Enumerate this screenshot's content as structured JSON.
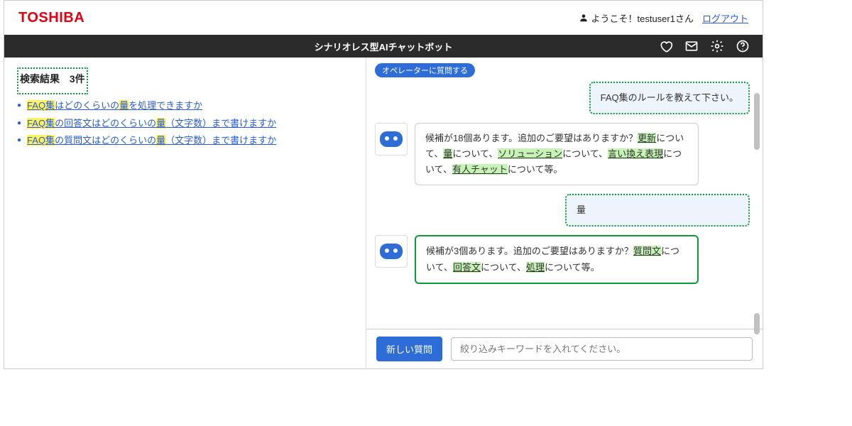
{
  "header": {
    "brand": "TOSHIBA",
    "welcome": "ようこそ！testuser1さん",
    "logout": "ログアウト"
  },
  "darkbar": {
    "title": "シナリオレス型AIチャットボット",
    "icons": [
      "heart-icon",
      "mail-icon",
      "gear-icon",
      "help-icon"
    ]
  },
  "left": {
    "search_label": "検索結果",
    "count": "3件",
    "results": [
      {
        "pre": "FAQ集",
        "mid1": "はどのくらいの",
        "hl2": "量",
        "post": "を処理できますか"
      },
      {
        "pre": "FAQ集",
        "mid1": "の回答文はどのくらいの",
        "hl2": "量",
        "post": "（文字数）まで書けますか"
      },
      {
        "pre": "FAQ集",
        "mid1": "の質問文はどのくらいの",
        "hl2": "量",
        "post": "（文字数）まで書けますか"
      }
    ]
  },
  "chat": {
    "operator_button": "オペレーターに質問する",
    "messages": [
      {
        "role": "user",
        "text": "FAQ集のルールを教えて下さい。",
        "callout": "dotted"
      },
      {
        "role": "bot",
        "segments": [
          {
            "t": "候補が18個あります。追加のご要望はありますか？"
          },
          {
            "kw": "更新"
          },
          {
            "t": "について、"
          },
          {
            "kw": "量"
          },
          {
            "t": "について、"
          },
          {
            "kw": "ソリューション"
          },
          {
            "t": "について、"
          },
          {
            "kw": "言い換え表現"
          },
          {
            "t": "について、"
          },
          {
            "kw": "有人チャット"
          },
          {
            "t": "について等。"
          }
        ]
      },
      {
        "role": "user",
        "text": "量",
        "callout": "dotted"
      },
      {
        "role": "bot",
        "callout": "solid",
        "segments": [
          {
            "t": "候補が3個あります。追加のご要望はありますか？"
          },
          {
            "kw": "質問文"
          },
          {
            "t": "について、"
          },
          {
            "kw": "回答文"
          },
          {
            "t": "について、"
          },
          {
            "kw": "処理"
          },
          {
            "t": "について等。"
          }
        ]
      }
    ],
    "new_question": "新しい質問",
    "input_placeholder": "絞り込みキーワードを入れてください。"
  }
}
